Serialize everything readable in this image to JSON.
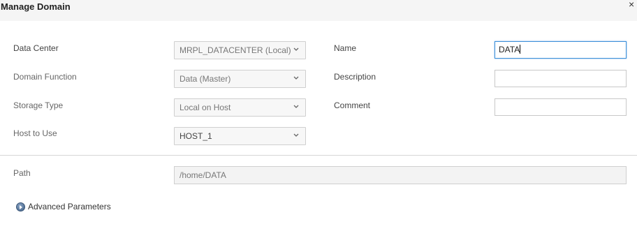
{
  "dialog": {
    "title": "Manage Domain",
    "close_glyph": "×"
  },
  "fields": {
    "data_center": {
      "label": "Data Center",
      "value": "MRPL_DATACENTER (Local)"
    },
    "domain_function": {
      "label": "Domain Function",
      "value": "Data (Master)"
    },
    "storage_type": {
      "label": "Storage Type",
      "value": "Local on Host"
    },
    "host_to_use": {
      "label": "Host to Use",
      "value": "HOST_1"
    },
    "name": {
      "label": "Name",
      "value": "DATA"
    },
    "description": {
      "label": "Description",
      "value": ""
    },
    "comment": {
      "label": "Comment",
      "value": ""
    },
    "path": {
      "label": "Path",
      "value": "/home/DATA"
    }
  },
  "advanced": {
    "label": "Advanced Parameters"
  },
  "icons": {
    "select_chevron": "chevron-down-icon",
    "advanced_expand": "expand-arrow-icon",
    "close": "close-icon"
  },
  "colors": {
    "header_bg": "#f5f5f5",
    "focus_border": "#3b8fd9",
    "disabled_bg": "#f3f3f3"
  }
}
